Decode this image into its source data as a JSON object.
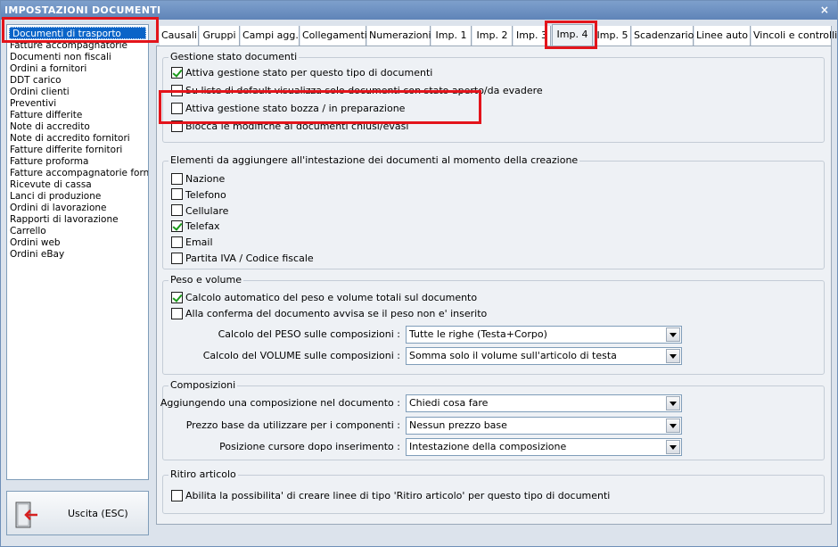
{
  "window": {
    "title": "IMPOSTAZIONI DOCUMENTI",
    "close_glyph": "×"
  },
  "sidebar": {
    "items": [
      {
        "label": "Documenti di trasporto",
        "selected": true
      },
      {
        "label": "Fatture accompagnatorie"
      },
      {
        "label": "Documenti non fiscali"
      },
      {
        "label": "Ordini a fornitori"
      },
      {
        "label": "DDT carico"
      },
      {
        "label": "Ordini clienti"
      },
      {
        "label": "Preventivi"
      },
      {
        "label": "Fatture differite"
      },
      {
        "label": "Note di accredito"
      },
      {
        "label": "Note di accredito fornitori"
      },
      {
        "label": "Fatture differite fornitori"
      },
      {
        "label": "Fatture proforma"
      },
      {
        "label": "Fatture accompagnatorie fornitori"
      },
      {
        "label": "Ricevute di cassa"
      },
      {
        "label": "Lanci di produzione"
      },
      {
        "label": "Ordini di lavorazione"
      },
      {
        "label": "Rapporti di lavorazione"
      },
      {
        "label": "Carrello"
      },
      {
        "label": "Ordini web"
      },
      {
        "label": "Ordini eBay"
      }
    ]
  },
  "exit_button": {
    "label": "Uscita (ESC)",
    "icon": "exit-door-icon"
  },
  "tabs": [
    {
      "label": "Causali"
    },
    {
      "label": "Gruppi"
    },
    {
      "label": "Campi agg."
    },
    {
      "label": "Collegamenti"
    },
    {
      "label": "Numerazioni"
    },
    {
      "label": "Imp. 1"
    },
    {
      "label": "Imp. 2"
    },
    {
      "label": "Imp. 3"
    },
    {
      "label": "Imp. 4",
      "active": true
    },
    {
      "label": "Imp. 5"
    },
    {
      "label": "Scadenzario"
    },
    {
      "label": "Linee auto"
    },
    {
      "label": "Vincoli e controlli"
    }
  ],
  "gestione_stato": {
    "title": "Gestione stato documenti",
    "options": [
      {
        "label": "Attiva gestione stato per questo tipo di documenti",
        "checked": true
      },
      {
        "label": "Su liste di default visualizza solo documenti con stato aperto/da evadere",
        "checked": false
      },
      {
        "label": "Attiva gestione stato bozza / in preparazione",
        "checked": false
      },
      {
        "label": "Blocca le modifiche ai documenti chiusi/evasi",
        "checked": false
      }
    ]
  },
  "elementi_intestazione": {
    "title": "Elementi da aggiungere all'intestazione dei documenti al momento della creazione",
    "options": [
      {
        "label": "Nazione",
        "checked": false
      },
      {
        "label": "Telefono",
        "checked": false
      },
      {
        "label": "Cellulare",
        "checked": false
      },
      {
        "label": "Telefax",
        "checked": true
      },
      {
        "label": "Email",
        "checked": false
      },
      {
        "label": "Partita IVA / Codice fiscale",
        "checked": false
      }
    ]
  },
  "peso_volume": {
    "title": "Peso e volume",
    "options": [
      {
        "label": "Calcolo automatico del peso e volume totali sul documento",
        "checked": true
      },
      {
        "label": "Alla conferma del documento avvisa se il peso non e' inserito",
        "checked": false
      }
    ],
    "fields": [
      {
        "label": "Calcolo del PESO sulle composizioni :",
        "value": "Tutte le righe (Testa+Corpo)"
      },
      {
        "label": "Calcolo del VOLUME sulle composizioni :",
        "value": "Somma solo il volume sull'articolo di testa"
      }
    ]
  },
  "composizioni": {
    "title": "Composizioni",
    "fields": [
      {
        "label": "Aggiungendo una composizione nel documento :",
        "value": "Chiedi cosa fare"
      },
      {
        "label": "Prezzo base da utilizzare per i componenti :",
        "value": "Nessun prezzo base"
      },
      {
        "label": "Posizione cursore dopo inserimento :",
        "value": "Intestazione della composizione"
      }
    ]
  },
  "ritiro_articolo": {
    "title": "Ritiro articolo",
    "options": [
      {
        "label": "Abilita la possibilita' di creare linee di tipo 'Ritiro articolo' per questo tipo di documenti",
        "checked": false
      }
    ]
  },
  "colors": {
    "highlight": "#e3141b",
    "selection": "#0a64c8",
    "check": "#1a9a1a"
  }
}
